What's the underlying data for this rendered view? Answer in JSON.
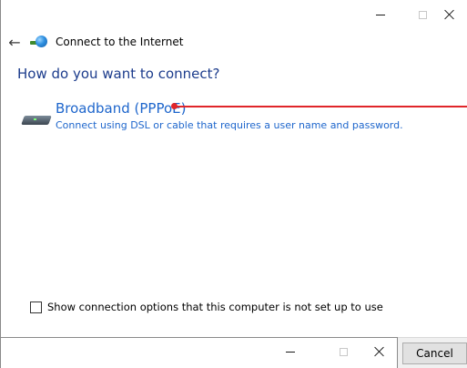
{
  "window": {
    "title": "Connect to the Internet",
    "heading": "How do you want to connect?"
  },
  "options": [
    {
      "title": "Broadband (PPPoE)",
      "description": "Connect using DSL or cable that requires a user name and password.",
      "icon": "broadband-modem-icon"
    }
  ],
  "checkbox": {
    "label": "Show connection options that this computer is not set up to use",
    "checked": false
  },
  "footer": {
    "cancel_label": "Cancel"
  },
  "colors": {
    "link_blue": "#1e66cc",
    "heading_blue": "#1c3c8c",
    "annotation_red": "#e0252a"
  }
}
